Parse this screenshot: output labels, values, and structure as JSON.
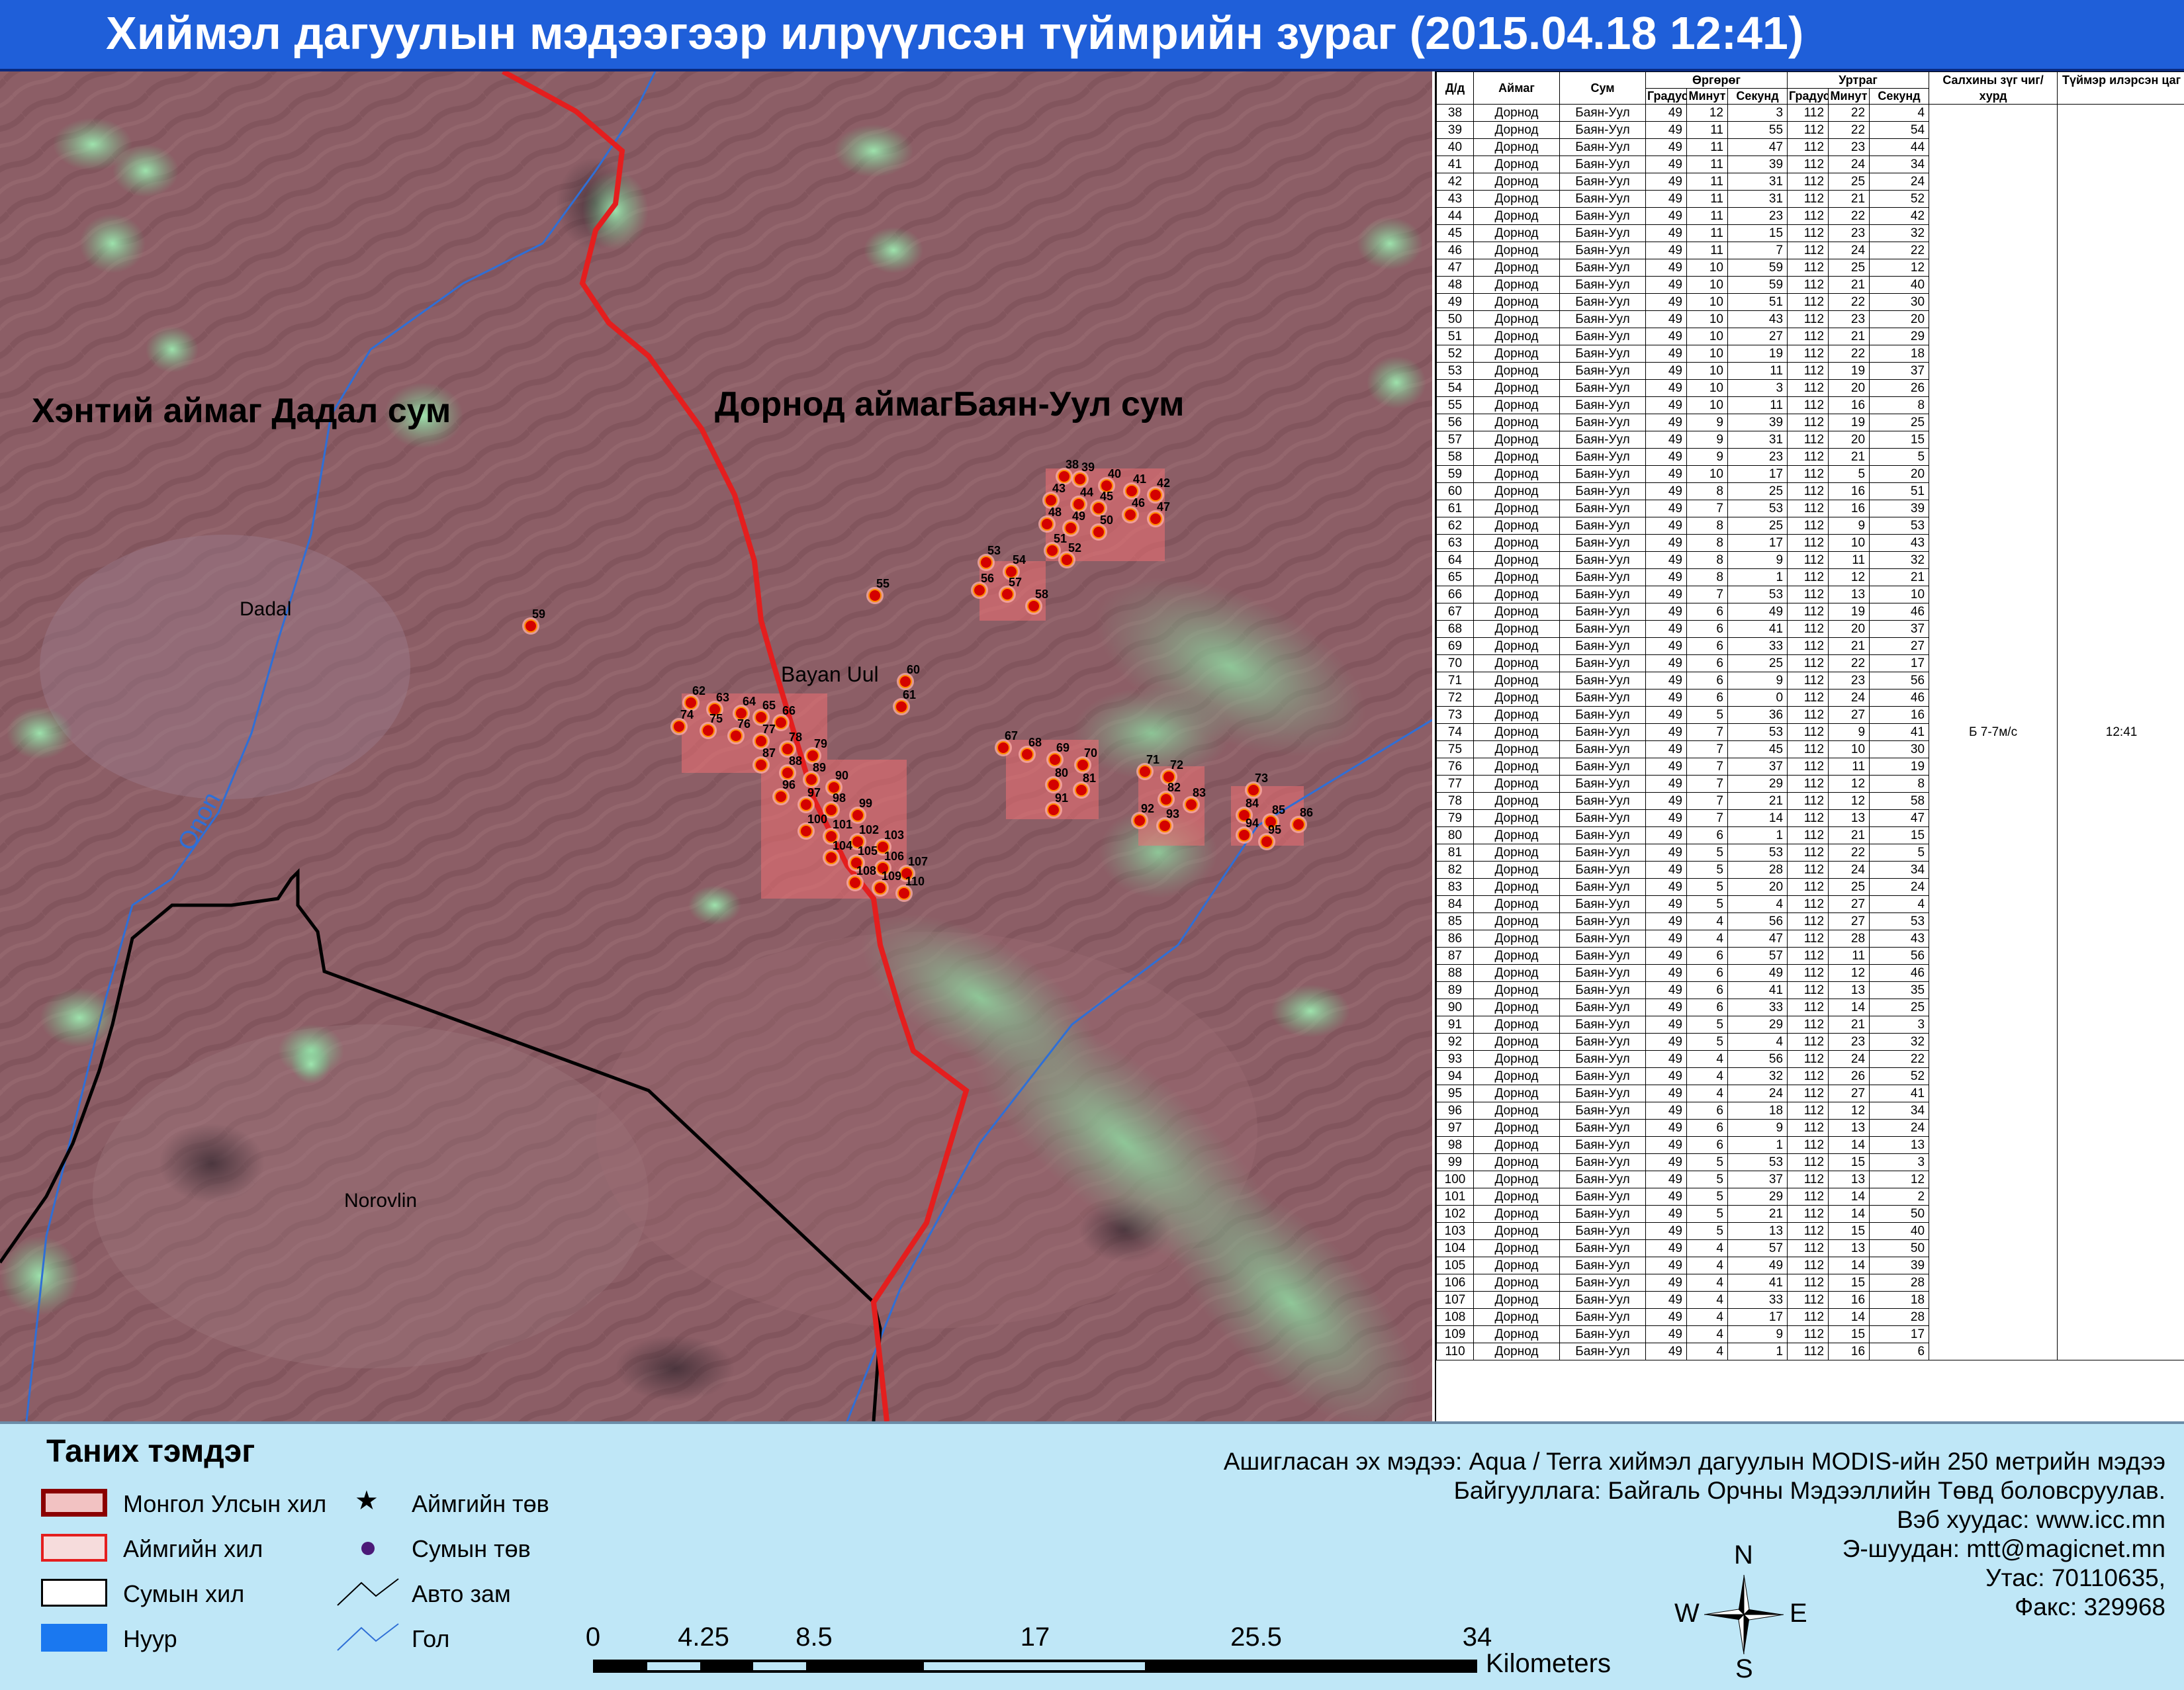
{
  "title": "Хиймэл дагуулын мэдээгээр илрүүлсэн түймрийн зураг  (2015.04.18 12:41)",
  "map": {
    "label_left": "Хэнтий аймаг Дадал сум",
    "label_right": "Дорнод аймагБаян-Уул сум",
    "place_dadal": "Dadal",
    "place_bayan_uul": "Bayan Uul",
    "place_norovlin": "Norovlin",
    "river_label": "Onon"
  },
  "table": {
    "headers": {
      "id": "Д/д",
      "aimag": "Аймаг",
      "sum": "Сум",
      "lat": "Өргөрөг",
      "lon": "Уртраг",
      "wind": "Салхины зүг чиг/хурд",
      "time": "Түймэр илэрсэн цаг",
      "deg": "Градус",
      "min": "Минут",
      "sec": "Секунд"
    },
    "wind_value": "Б 7-7м/с",
    "time_value": "12:41",
    "rows": [
      [
        38,
        "Дорнод",
        "Баян-Уул",
        49,
        12,
        3,
        112,
        22,
        4
      ],
      [
        39,
        "Дорнод",
        "Баян-Уул",
        49,
        11,
        55,
        112,
        22,
        54
      ],
      [
        40,
        "Дорнод",
        "Баян-Уул",
        49,
        11,
        47,
        112,
        23,
        44
      ],
      [
        41,
        "Дорнод",
        "Баян-Уул",
        49,
        11,
        39,
        112,
        24,
        34
      ],
      [
        42,
        "Дорнод",
        "Баян-Уул",
        49,
        11,
        31,
        112,
        25,
        24
      ],
      [
        43,
        "Дорнод",
        "Баян-Уул",
        49,
        11,
        31,
        112,
        21,
        52
      ],
      [
        44,
        "Дорнод",
        "Баян-Уул",
        49,
        11,
        23,
        112,
        22,
        42
      ],
      [
        45,
        "Дорнод",
        "Баян-Уул",
        49,
        11,
        15,
        112,
        23,
        32
      ],
      [
        46,
        "Дорнод",
        "Баян-Уул",
        49,
        11,
        7,
        112,
        24,
        22
      ],
      [
        47,
        "Дорнод",
        "Баян-Уул",
        49,
        10,
        59,
        112,
        25,
        12
      ],
      [
        48,
        "Дорнод",
        "Баян-Уул",
        49,
        10,
        59,
        112,
        21,
        40
      ],
      [
        49,
        "Дорнод",
        "Баян-Уул",
        49,
        10,
        51,
        112,
        22,
        30
      ],
      [
        50,
        "Дорнод",
        "Баян-Уул",
        49,
        10,
        43,
        112,
        23,
        20
      ],
      [
        51,
        "Дорнод",
        "Баян-Уул",
        49,
        10,
        27,
        112,
        21,
        29
      ],
      [
        52,
        "Дорнод",
        "Баян-Уул",
        49,
        10,
        19,
        112,
        22,
        18
      ],
      [
        53,
        "Дорнод",
        "Баян-Уул",
        49,
        10,
        11,
        112,
        19,
        37
      ],
      [
        54,
        "Дорнод",
        "Баян-Уул",
        49,
        10,
        3,
        112,
        20,
        26
      ],
      [
        55,
        "Дорнод",
        "Баян-Уул",
        49,
        10,
        11,
        112,
        16,
        8
      ],
      [
        56,
        "Дорнод",
        "Баян-Уул",
        49,
        9,
        39,
        112,
        19,
        25
      ],
      [
        57,
        "Дорнод",
        "Баян-Уул",
        49,
        9,
        31,
        112,
        20,
        15
      ],
      [
        58,
        "Дорнод",
        "Баян-Уул",
        49,
        9,
        23,
        112,
        21,
        5
      ],
      [
        59,
        "Дорнод",
        "Баян-Уул",
        49,
        10,
        17,
        112,
        5,
        20
      ],
      [
        60,
        "Дорнод",
        "Баян-Уул",
        49,
        8,
        25,
        112,
        16,
        51
      ],
      [
        61,
        "Дорнод",
        "Баян-Уул",
        49,
        7,
        53,
        112,
        16,
        39
      ],
      [
        62,
        "Дорнод",
        "Баян-Уул",
        49,
        8,
        25,
        112,
        9,
        53
      ],
      [
        63,
        "Дорнод",
        "Баян-Уул",
        49,
        8,
        17,
        112,
        10,
        43
      ],
      [
        64,
        "Дорнод",
        "Баян-Уул",
        49,
        8,
        9,
        112,
        11,
        32
      ],
      [
        65,
        "Дорнод",
        "Баян-Уул",
        49,
        8,
        1,
        112,
        12,
        21
      ],
      [
        66,
        "Дорнод",
        "Баян-Уул",
        49,
        7,
        53,
        112,
        13,
        10
      ],
      [
        67,
        "Дорнод",
        "Баян-Уул",
        49,
        6,
        49,
        112,
        19,
        46
      ],
      [
        68,
        "Дорнод",
        "Баян-Уул",
        49,
        6,
        41,
        112,
        20,
        37
      ],
      [
        69,
        "Дорнод",
        "Баян-Уул",
        49,
        6,
        33,
        112,
        21,
        27
      ],
      [
        70,
        "Дорнод",
        "Баян-Уул",
        49,
        6,
        25,
        112,
        22,
        17
      ],
      [
        71,
        "Дорнод",
        "Баян-Уул",
        49,
        6,
        9,
        112,
        23,
        56
      ],
      [
        72,
        "Дорнод",
        "Баян-Уул",
        49,
        6,
        0,
        112,
        24,
        46
      ],
      [
        73,
        "Дорнод",
        "Баян-Уул",
        49,
        5,
        36,
        112,
        27,
        16
      ],
      [
        74,
        "Дорнод",
        "Баян-Уул",
        49,
        7,
        53,
        112,
        9,
        41
      ],
      [
        75,
        "Дорнод",
        "Баян-Уул",
        49,
        7,
        45,
        112,
        10,
        30
      ],
      [
        76,
        "Дорнод",
        "Баян-Уул",
        49,
        7,
        37,
        112,
        11,
        19
      ],
      [
        77,
        "Дорнод",
        "Баян-Уул",
        49,
        7,
        29,
        112,
        12,
        8
      ],
      [
        78,
        "Дорнод",
        "Баян-Уул",
        49,
        7,
        21,
        112,
        12,
        58
      ],
      [
        79,
        "Дорнод",
        "Баян-Уул",
        49,
        7,
        14,
        112,
        13,
        47
      ],
      [
        80,
        "Дорнод",
        "Баян-Уул",
        49,
        6,
        1,
        112,
        21,
        15
      ],
      [
        81,
        "Дорнод",
        "Баян-Уул",
        49,
        5,
        53,
        112,
        22,
        5
      ],
      [
        82,
        "Дорнод",
        "Баян-Уул",
        49,
        5,
        28,
        112,
        24,
        34
      ],
      [
        83,
        "Дорнод",
        "Баян-Уул",
        49,
        5,
        20,
        112,
        25,
        24
      ],
      [
        84,
        "Дорнод",
        "Баян-Уул",
        49,
        5,
        4,
        112,
        27,
        4
      ],
      [
        85,
        "Дорнод",
        "Баян-Уул",
        49,
        4,
        56,
        112,
        27,
        53
      ],
      [
        86,
        "Дорнод",
        "Баян-Уул",
        49,
        4,
        47,
        112,
        28,
        43
      ],
      [
        87,
        "Дорнод",
        "Баян-Уул",
        49,
        6,
        57,
        112,
        11,
        56
      ],
      [
        88,
        "Дорнод",
        "Баян-Уул",
        49,
        6,
        49,
        112,
        12,
        46
      ],
      [
        89,
        "Дорнод",
        "Баян-Уул",
        49,
        6,
        41,
        112,
        13,
        35
      ],
      [
        90,
        "Дорнод",
        "Баян-Уул",
        49,
        6,
        33,
        112,
        14,
        25
      ],
      [
        91,
        "Дорнод",
        "Баян-Уул",
        49,
        5,
        29,
        112,
        21,
        3
      ],
      [
        92,
        "Дорнод",
        "Баян-Уул",
        49,
        5,
        4,
        112,
        23,
        32
      ],
      [
        93,
        "Дорнод",
        "Баян-Уул",
        49,
        4,
        56,
        112,
        24,
        22
      ],
      [
        94,
        "Дорнод",
        "Баян-Уул",
        49,
        4,
        32,
        112,
        26,
        52
      ],
      [
        95,
        "Дорнод",
        "Баян-Уул",
        49,
        4,
        24,
        112,
        27,
        41
      ],
      [
        96,
        "Дорнод",
        "Баян-Уул",
        49,
        6,
        18,
        112,
        12,
        34
      ],
      [
        97,
        "Дорнод",
        "Баян-Уул",
        49,
        6,
        9,
        112,
        13,
        24
      ],
      [
        98,
        "Дорнод",
        "Баян-Уул",
        49,
        6,
        1,
        112,
        14,
        13
      ],
      [
        99,
        "Дорнод",
        "Баян-Уул",
        49,
        5,
        53,
        112,
        15,
        3
      ],
      [
        100,
        "Дорнод",
        "Баян-Уул",
        49,
        5,
        37,
        112,
        13,
        12
      ],
      [
        101,
        "Дорнод",
        "Баян-Уул",
        49,
        5,
        29,
        112,
        14,
        2
      ],
      [
        102,
        "Дорнод",
        "Баян-Уул",
        49,
        5,
        21,
        112,
        14,
        50
      ],
      [
        103,
        "Дорнод",
        "Баян-Уул",
        49,
        5,
        13,
        112,
        15,
        40
      ],
      [
        104,
        "Дорнод",
        "Баян-Уул",
        49,
        4,
        57,
        112,
        13,
        50
      ],
      [
        105,
        "Дорнод",
        "Баян-Уул",
        49,
        4,
        49,
        112,
        14,
        39
      ],
      [
        106,
        "Дорнод",
        "Баян-Уул",
        49,
        4,
        41,
        112,
        15,
        28
      ],
      [
        107,
        "Дорнод",
        "Баян-Уул",
        49,
        4,
        33,
        112,
        16,
        18
      ],
      [
        108,
        "Дорнод",
        "Баян-Уул",
        49,
        4,
        17,
        112,
        14,
        28
      ],
      [
        109,
        "Дорнод",
        "Баян-Уул",
        49,
        4,
        9,
        112,
        15,
        17
      ],
      [
        110,
        "Дорнод",
        "Баян-Уул",
        49,
        4,
        1,
        112,
        16,
        6
      ]
    ]
  },
  "legend": {
    "title": "Таних тэмдэг",
    "items": {
      "country": "Монгол Улсын хил",
      "aimag_border": "Аймгийн хил",
      "sum_border": "Сумын хил",
      "lake": "Нуур",
      "aimag_center": "Аймгийн төв",
      "sum_center": "Сумын төв",
      "road": "Авто зам",
      "river": "Гол"
    },
    "colors": {
      "country": "#8b0000",
      "aimag": "#e41e1e",
      "sum": "#000000",
      "lake": "#1a78f0",
      "river": "#2f6fd6",
      "sum_center": "#4b1a78"
    }
  },
  "source": {
    "line1": "Ашигласан эх мэдээ: Aqua / Terra хиймэл дагуулын MODIS-ийн 250 метрийн мэдээ",
    "line2": "Байгууллага: Байгаль Орчны Мэдээллийн Төвд боловсруулав.",
    "line3": "Вэб хуудас: www.icc.mn",
    "line4": "Э-шуудан: mtt@magicnet.mn",
    "line5": "Утас: 70110635,",
    "line6": "Факс: 329968"
  },
  "scalebar": {
    "labels": [
      "0",
      "4.25",
      "8.5",
      "17",
      "25.5",
      "34"
    ],
    "units": "Kilometers"
  },
  "compass": {
    "n": "N",
    "s": "S",
    "e": "E",
    "w": "W"
  },
  "fires": {
    "38": [
      1608,
      612
    ],
    "39": [
      1632,
      616
    ],
    "40": [
      1672,
      626
    ],
    "41": [
      1710,
      634
    ],
    "42": [
      1746,
      640
    ],
    "43": [
      1588,
      648
    ],
    "44": [
      1630,
      654
    ],
    "45": [
      1660,
      660
    ],
    "46": [
      1708,
      670
    ],
    "47": [
      1746,
      676
    ],
    "48": [
      1582,
      684
    ],
    "49": [
      1618,
      690
    ],
    "50": [
      1660,
      696
    ],
    "51": [
      1590,
      724
    ],
    "52": [
      1612,
      738
    ],
    "53": [
      1490,
      742
    ],
    "54": [
      1528,
      756
    ],
    "55": [
      1322,
      792
    ],
    "56": [
      1480,
      784
    ],
    "57": [
      1522,
      790
    ],
    "58": [
      1562,
      808
    ],
    "59": [
      802,
      838
    ],
    "60": [
      1368,
      922
    ],
    "61": [
      1362,
      960
    ],
    "62": [
      1044,
      954
    ],
    "63": [
      1080,
      964
    ],
    "64": [
      1120,
      970
    ],
    "65": [
      1150,
      976
    ],
    "66": [
      1180,
      984
    ],
    "67": [
      1516,
      1022
    ],
    "68": [
      1552,
      1032
    ],
    "69": [
      1594,
      1040
    ],
    "70": [
      1636,
      1048
    ],
    "71": [
      1730,
      1058
    ],
    "72": [
      1766,
      1066
    ],
    "73": [
      1894,
      1086
    ],
    "74": [
      1026,
      990
    ],
    "75": [
      1070,
      996
    ],
    "76": [
      1112,
      1004
    ],
    "77": [
      1150,
      1012
    ],
    "78": [
      1190,
      1024
    ],
    "79": [
      1228,
      1034
    ],
    "80": [
      1592,
      1078
    ],
    "81": [
      1634,
      1086
    ],
    "82": [
      1762,
      1100
    ],
    "83": [
      1800,
      1108
    ],
    "84": [
      1880,
      1124
    ],
    "85": [
      1920,
      1134
    ],
    "86": [
      1962,
      1138
    ],
    "87": [
      1150,
      1048
    ],
    "88": [
      1190,
      1060
    ],
    "89": [
      1226,
      1070
    ],
    "90": [
      1260,
      1082
    ],
    "91": [
      1592,
      1116
    ],
    "92": [
      1722,
      1132
    ],
    "93": [
      1760,
      1140
    ],
    "94": [
      1880,
      1154
    ],
    "95": [
      1914,
      1164
    ],
    "96": [
      1180,
      1096
    ],
    "97": [
      1218,
      1108
    ],
    "98": [
      1256,
      1116
    ],
    "99": [
      1296,
      1124
    ],
    "100": [
      1218,
      1148
    ],
    "101": [
      1256,
      1156
    ],
    "102": [
      1296,
      1164
    ],
    "103": [
      1334,
      1172
    ],
    "104": [
      1256,
      1188
    ],
    "105": [
      1294,
      1196
    ],
    "106": [
      1334,
      1204
    ],
    "107": [
      1370,
      1212
    ],
    "108": [
      1292,
      1226
    ],
    "109": [
      1330,
      1234
    ],
    "110": [
      1366,
      1242
    ]
  }
}
